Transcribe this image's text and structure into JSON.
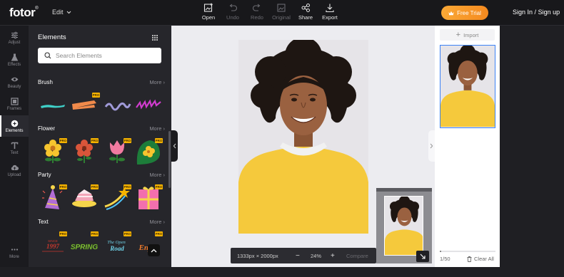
{
  "header": {
    "logo": "fotor",
    "logo_mark": "®",
    "edit_menu": "Edit",
    "tools": [
      {
        "label": "Open",
        "icon": "image-plus-icon",
        "enabled": true
      },
      {
        "label": "Undo",
        "icon": "undo-icon",
        "enabled": false
      },
      {
        "label": "Redo",
        "icon": "redo-icon",
        "enabled": false
      },
      {
        "label": "Original",
        "icon": "image-original-icon",
        "enabled": false
      },
      {
        "label": "Share",
        "icon": "share-icon",
        "enabled": true
      },
      {
        "label": "Export",
        "icon": "download-icon",
        "enabled": true
      }
    ],
    "free_trial": "Free Trial",
    "sign_in": "Sign In",
    "separator": "/",
    "sign_up": "Sign up"
  },
  "rail": {
    "items": [
      {
        "label": "Adjust",
        "icon": "sliders-icon"
      },
      {
        "label": "Effects",
        "icon": "flask-icon"
      },
      {
        "label": "Beauty",
        "icon": "eye-icon"
      },
      {
        "label": "Frames",
        "icon": "frame-icon"
      },
      {
        "label": "Elements",
        "icon": "elements-icon",
        "active": true
      },
      {
        "label": "Text",
        "icon": "text-icon"
      },
      {
        "label": "Upload",
        "icon": "cloud-upload-icon"
      }
    ],
    "more": "More"
  },
  "panel": {
    "title": "Elements",
    "search_placeholder": "Search Elements",
    "sections": [
      {
        "title": "Brush",
        "more": "More"
      },
      {
        "title": "Flower",
        "more": "More"
      },
      {
        "title": "Party",
        "more": "More"
      },
      {
        "title": "Text",
        "more": "More"
      }
    ],
    "pro_badge": "PRO",
    "text_stickers": [
      "SINCE 1997",
      "SPRING",
      "The Open Road",
      "Enjoy"
    ]
  },
  "canvas": {
    "dimensions": "1333px × 2000px",
    "minus": "−",
    "zoom": "24%",
    "plus": "+",
    "compare": "Compare"
  },
  "pages": {
    "import": "Import",
    "page_count": "1/50",
    "progress": 0.02,
    "clear_all": "Clear All"
  },
  "colors": {
    "accent_orange": "#f58a1f",
    "selection_blue": "#3b82f6",
    "sweater_yellow": "#f5c93c",
    "pro_gold": "#f6b400"
  }
}
